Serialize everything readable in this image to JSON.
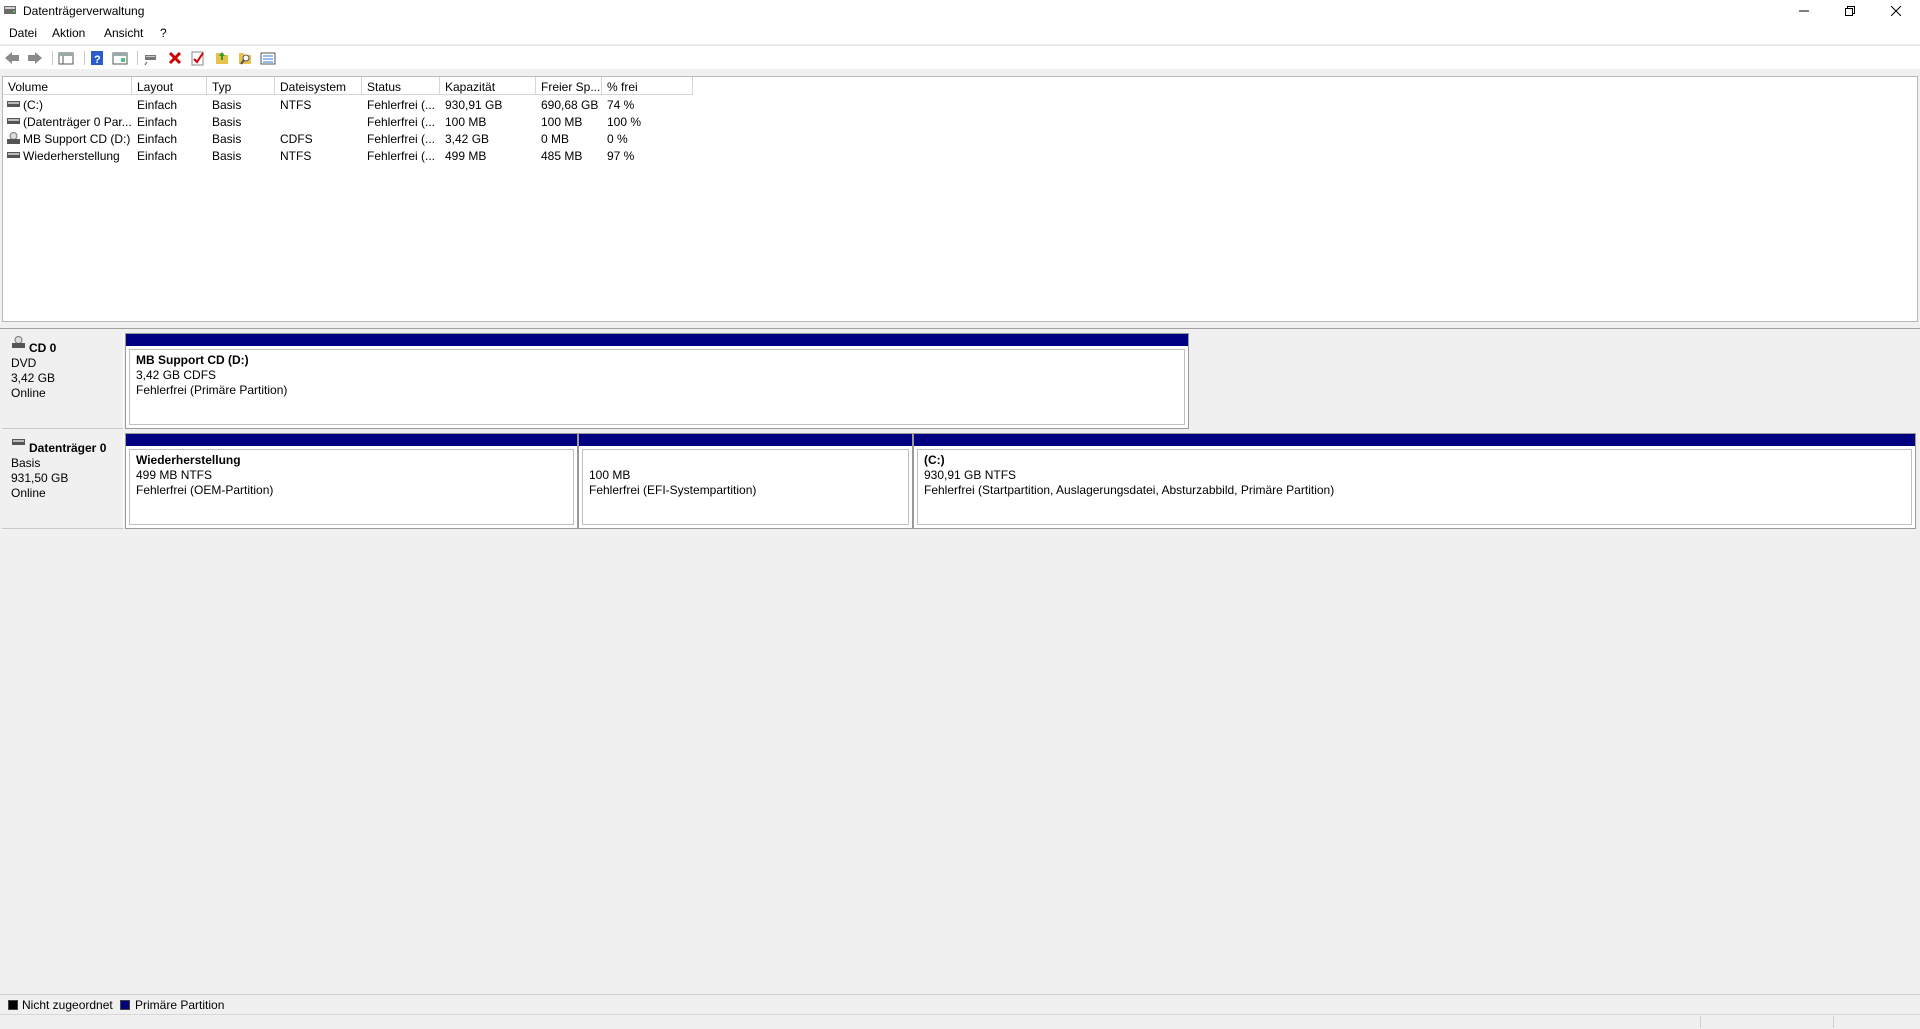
{
  "window": {
    "title": "Datenträgerverwaltung",
    "controls": {
      "minimize_icon": "minimize-icon",
      "restore_icon": "restore-icon",
      "close_icon": "close-icon"
    }
  },
  "menu": {
    "items": [
      {
        "label": "Datei"
      },
      {
        "label": "Aktion"
      },
      {
        "label": "Ansicht"
      },
      {
        "label": "?"
      }
    ]
  },
  "toolbar": {
    "buttons": [
      {
        "icon": "back-arrow-icon"
      },
      {
        "icon": "forward-arrow-icon"
      },
      {
        "icon": "show-hide-console-tree-icon"
      },
      {
        "icon": "help-icon"
      },
      {
        "icon": "properties-icon"
      },
      {
        "icon": "connect-icon"
      },
      {
        "icon": "delete-icon"
      },
      {
        "icon": "check-icon"
      },
      {
        "icon": "open-folder-icon"
      },
      {
        "icon": "search-folder-icon"
      },
      {
        "icon": "list-view-icon"
      }
    ]
  },
  "volume_list": {
    "columns": [
      "Volume",
      "Layout",
      "Typ",
      "Dateisystem",
      "Status",
      "Kapazität",
      "Freier Sp...",
      "% frei"
    ],
    "rows": [
      {
        "volume": "(C:)",
        "layout": "Einfach",
        "typ": "Basis",
        "dateisystem": "NTFS",
        "status": "Fehlerfrei (...",
        "kapazitaet": "930,91 GB",
        "frei": "690,68 GB",
        "prozent": "74 %",
        "icon": "drive-icon"
      },
      {
        "volume": "(Datenträger 0 Par...",
        "layout": "Einfach",
        "typ": "Basis",
        "dateisystem": "",
        "status": "Fehlerfrei (...",
        "kapazitaet": "100 MB",
        "frei": "100 MB",
        "prozent": "100 %",
        "icon": "drive-icon"
      },
      {
        "volume": "MB Support CD (D:)",
        "layout": "Einfach",
        "typ": "Basis",
        "dateisystem": "CDFS",
        "status": "Fehlerfrei (...",
        "kapazitaet": "3,42 GB",
        "frei": "0 MB",
        "prozent": "0 %",
        "icon": "cd-drive-icon"
      },
      {
        "volume": "Wiederherstellung",
        "layout": "Einfach",
        "typ": "Basis",
        "dateisystem": "NTFS",
        "status": "Fehlerfrei (...",
        "kapazitaet": "499 MB",
        "frei": "485 MB",
        "prozent": "97 %",
        "icon": "drive-icon"
      }
    ]
  },
  "disks": [
    {
      "name": "CD 0",
      "kind": "DVD",
      "size": "3,42 GB",
      "state": "Online",
      "icon": "cd-drive-icon",
      "partitions": [
        {
          "title": "MB Support CD  (D:)",
          "size": "3,42 GB CDFS",
          "status": "Fehlerfrei (Primäre Partition)"
        }
      ]
    },
    {
      "name": "Datenträger 0",
      "kind": "Basis",
      "size": "931,50 GB",
      "state": "Online",
      "icon": "hard-disk-icon",
      "partitions": [
        {
          "title": "Wiederherstellung",
          "size": "499 MB NTFS",
          "status": "Fehlerfrei (OEM-Partition)"
        },
        {
          "title": "",
          "size": "100 MB",
          "status": "Fehlerfrei (EFI-Systempartition)"
        },
        {
          "title": "(C:)",
          "size": "930,91 GB NTFS",
          "status": "Fehlerfrei (Startpartition, Auslagerungsdatei, Absturzabbild, Primäre Partition)"
        }
      ]
    }
  ],
  "legend": [
    {
      "label": "Nicht zugeordnet",
      "color": "#000000"
    },
    {
      "label": "Primäre Partition",
      "color": "#000080"
    }
  ],
  "colors": {
    "primary_partition": "#000080",
    "unallocated": "#000000"
  }
}
